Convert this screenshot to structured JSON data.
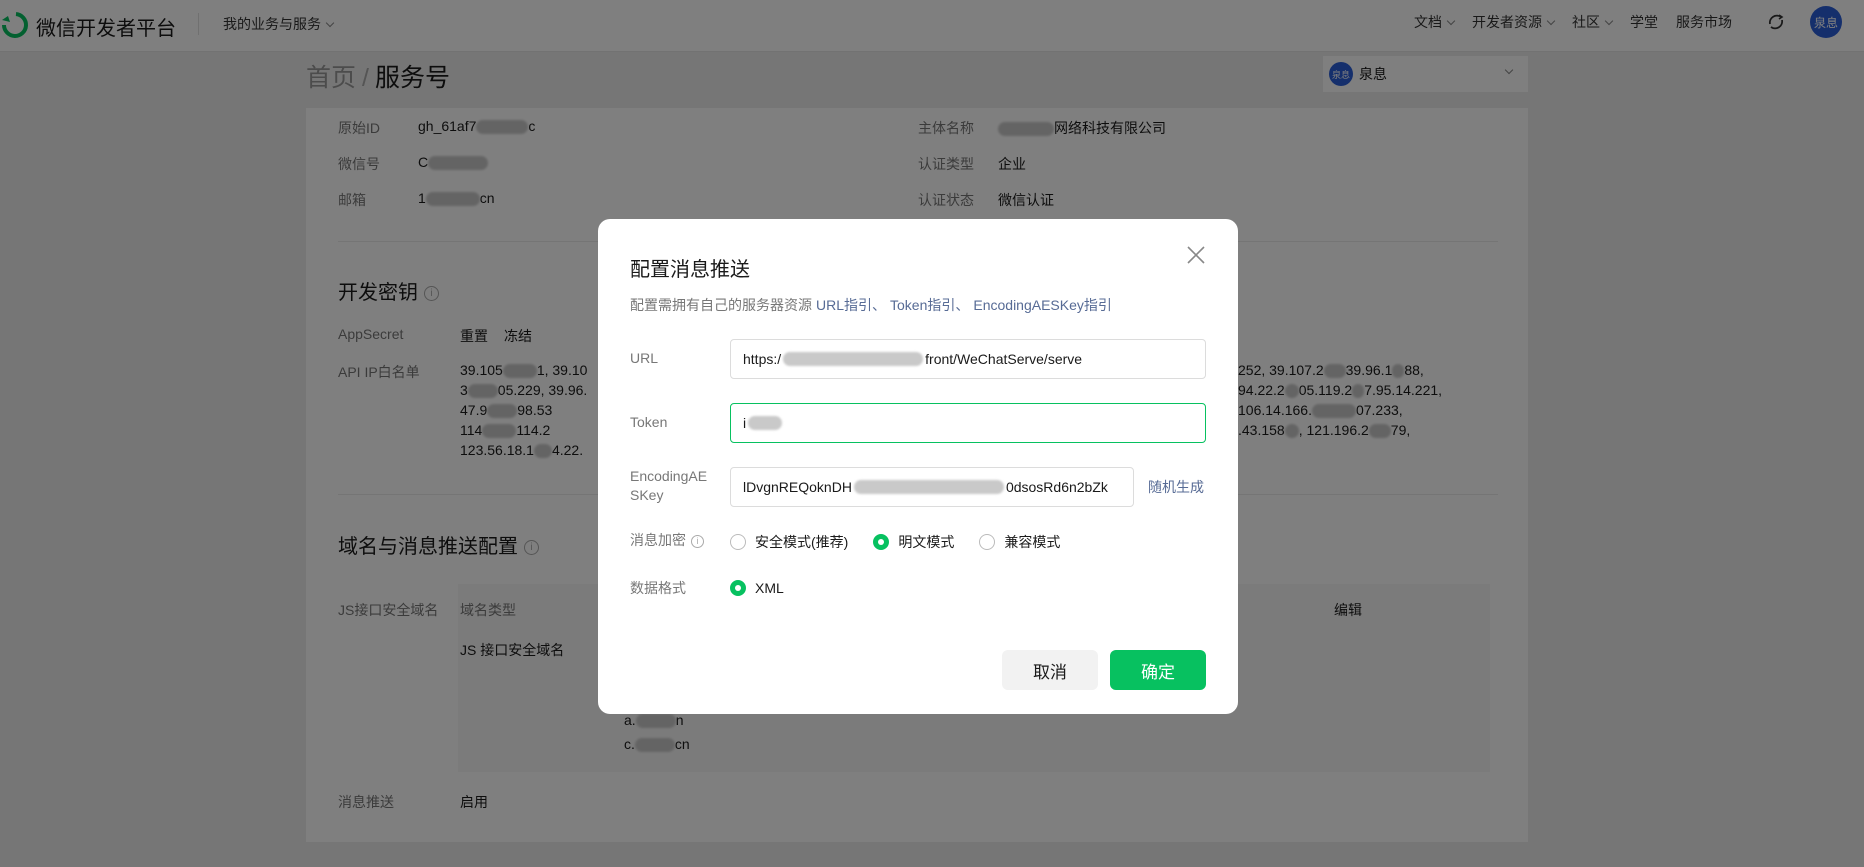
{
  "topbar": {
    "brand": "微信开发者平台",
    "biz_menu": "我的业务与服务",
    "nav": [
      "文档",
      "开发者资源",
      "社区",
      "学堂",
      "服务市场"
    ],
    "avatar_text": "泉息"
  },
  "header": {
    "crumb_home": "首页",
    "crumb_sep": "/",
    "crumb_current": "服务号",
    "account_avatar": "泉息",
    "account_name": "泉息"
  },
  "basic_info": {
    "original_id_label": "原始ID",
    "original_id_prefix": "gh_61af7",
    "original_id_suffix": "c",
    "wechat_id_label": "微信号",
    "wechat_id_prefix": "C",
    "email_label": "邮箱",
    "email_prefix": "1",
    "email_suffix": "cn",
    "entity_label": "主体名称",
    "entity_value": "网络科技有限公司",
    "cert_type_label": "认证类型",
    "cert_type_value": "企业",
    "cert_status_label": "认证状态",
    "cert_status_value": "微信认证"
  },
  "dev_key": {
    "title": "开发密钥",
    "appsecret_label": "AppSecret",
    "reset": "重置",
    "freeze": "冻结",
    "ip_label": "API IP白名单",
    "ip_left": [
      "39.105",
      "1, 39.10",
      "3",
      "05.229, 39.96.",
      "47.9",
      "98.53",
      "114",
      "114.2",
      "123.56.18.1",
      "4.22."
    ],
    "ip_right": [
      "252, 39.107.2",
      "39.96.1",
      "88,",
      "94.22.2",
      "05.119.2",
      "7.95.14.221,",
      "106.14.166.",
      "07.233,",
      ".43.158",
      ", 121.196.2",
      "79,"
    ]
  },
  "domain": {
    "title": "域名与消息推送配置",
    "js_label": "JS接口安全域名",
    "col_type": "域名类型",
    "row_type": "JS 接口安全域名",
    "edit": "编辑",
    "d1_prefix": "a.",
    "d1_suffix": "n",
    "d2_prefix": "c.",
    "d2_suffix": "cn",
    "push_label": "消息推送",
    "push_enable": "启用"
  },
  "dialog": {
    "title": "配置消息推送",
    "desc": "配置需拥有自己的服务器资源",
    "guide_url": "URL指引、",
    "guide_token": "Token指引、",
    "guide_aes": "EncodingAESKey指引",
    "url_label": "URL",
    "url_prefix": "https:/",
    "url_suffix": "front/WeChatServe/serve",
    "token_label": "Token",
    "token_prefix": "i",
    "aes_label": "EncodingAESKey",
    "aes_prefix": "lDvgnREQoknDH",
    "aes_suffix": "0dsosRd6n2bZk",
    "random": "随机生成",
    "encrypt_label": "消息加密",
    "encrypt_options": [
      "安全模式(推荐)",
      "明文模式",
      "兼容模式"
    ],
    "encrypt_selected": "明文模式",
    "format_label": "数据格式",
    "format_value": "XML",
    "cancel": "取消",
    "confirm": "确定"
  },
  "colors": {
    "primary": "#07c160",
    "link": "#576b95",
    "avatar": "#2b5ed8"
  }
}
